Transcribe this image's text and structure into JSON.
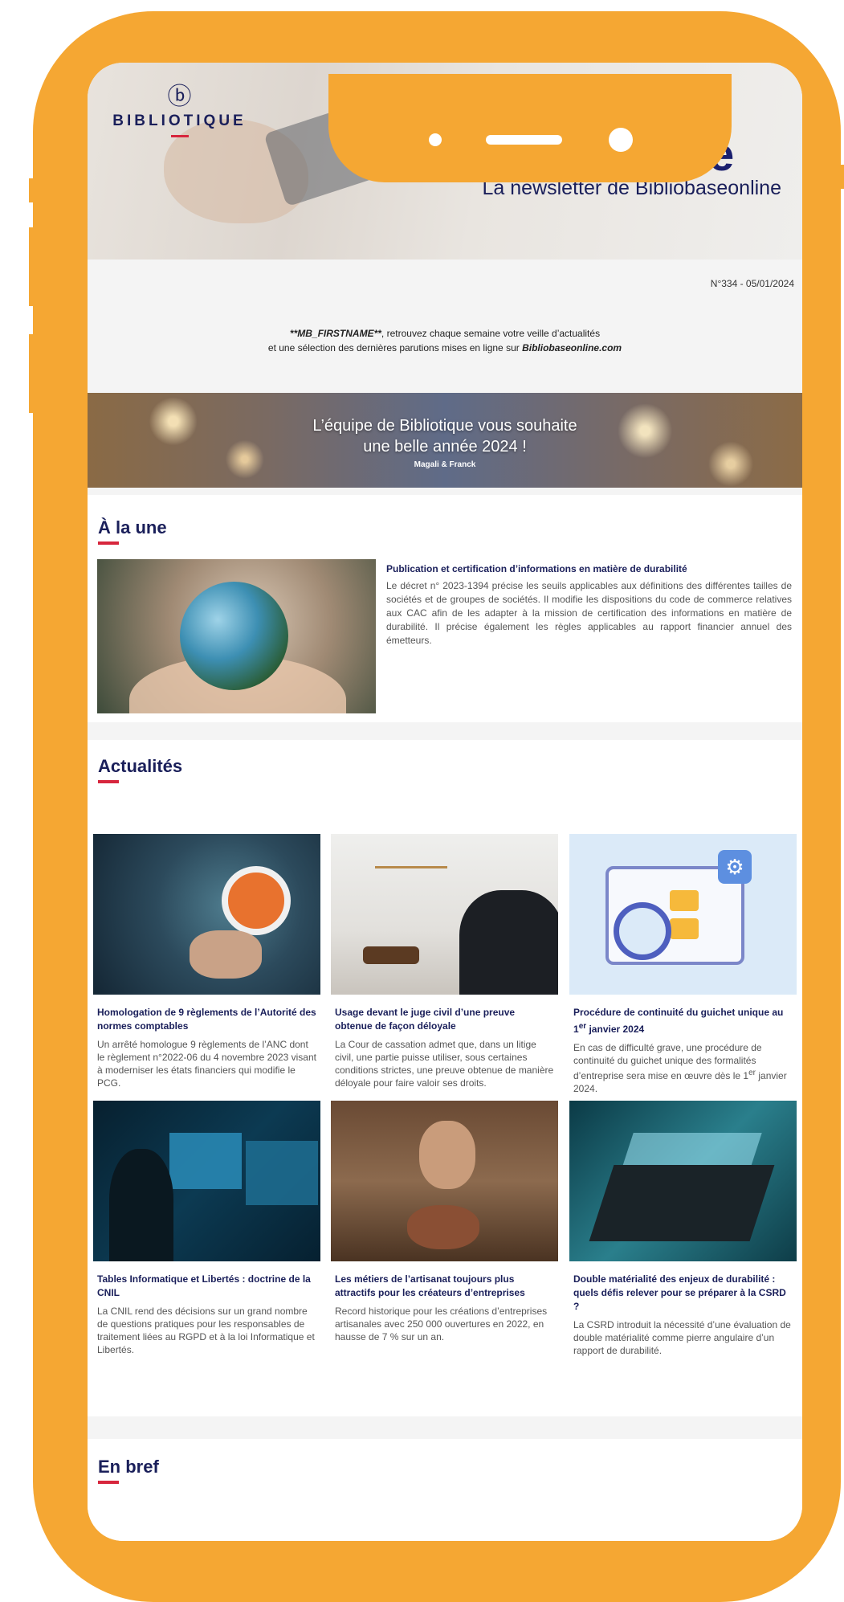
{
  "header": {
    "logo_glyph": "ⓑ",
    "logo_text": "BIBLIOTIQUE",
    "title": "C’est@Lire",
    "subtitle": "La newsletter de Bibliobaseonline"
  },
  "issue": "N°334 - 05/01/2024",
  "intro": {
    "line1_placeholder": "**MB_FIRSTNAME**",
    "line1_rest": ", retrouvez chaque semaine votre veille d’actualités",
    "line2_prefix": "et une sélection des dernières parutions mises en ligne sur ",
    "line2_link": "Bibliobaseonline.com"
  },
  "greeting": {
    "line1": "L’équipe de Bibliotique vous souhaite",
    "line2": "une belle année 2024 !",
    "signature": "Magali & Franck"
  },
  "a_la_une": {
    "heading": "À la une",
    "title": "Publication et certification d’informations en matière de durabilité",
    "body": "Le décret n° 2023-1394 précise les seuils applicables aux définitions des différentes tailles de sociétés et de groupes de sociétés. Il modifie les dispositions du code de commerce relatives aux CAC afin de les adapter à la mission de certification des informations en matière de durabilité. Il précise également les règles applicables au rapport financier annuel des émetteurs."
  },
  "actualites": {
    "heading": "Actualités",
    "articles": [
      {
        "title": "Homologation de 9 règlements de l’Autorité des normes comptables",
        "body": "Un arrêté homologue 9 règlements de l’ANC dont le règlement n°2022-06 du 4 novembre 2023 visant à moderniser les états financiers qui modifie le PCG."
      },
      {
        "title": "Usage devant le juge civil d’une preuve obtenue de façon déloyale",
        "body": "La Cour de cassation admet que, dans un litige civil, une partie puisse utiliser, sous certaines conditions strictes, une preuve obtenue de manière déloyale pour faire valoir ses droits."
      },
      {
        "title_prefix": "Procédure de continuité du guichet unique au 1",
        "title_sup": "er",
        "title_suffix": " janvier 2024",
        "body_prefix": "En cas de difficulté grave, une procédure de continuité du guichet unique des formalités d’entreprise sera mise en œuvre dès le 1",
        "body_sup": "er",
        "body_suffix": " janvier 2024."
      },
      {
        "title": "Tables Informatique et Libertés : doctrine de la CNIL",
        "body": "La CNIL rend des décisions sur un grand nombre de questions pratiques pour les responsables de traitement liées au RGPD et à la loi Informatique et Libertés."
      },
      {
        "title": "Les métiers de l’artisanat toujours plus attractifs pour les créateurs d’entreprises",
        "body": "Record historique pour les créations d’entreprises artisanales avec 250 000 ouvertures en 2022, en hausse de 7 % sur un an."
      },
      {
        "title": "Double matérialité des enjeux de durabilité : quels défis relever pour se préparer à la CSRD ?",
        "body": "La CSRD introduit la nécessité d’une évaluation de double matérialité comme pierre angulaire d’un rapport de durabilité."
      }
    ]
  },
  "en_bref": {
    "heading": "En bref"
  },
  "colors": {
    "frame": "#f5a733",
    "navy": "#1a1f5a",
    "accent_red": "#d7263d"
  }
}
